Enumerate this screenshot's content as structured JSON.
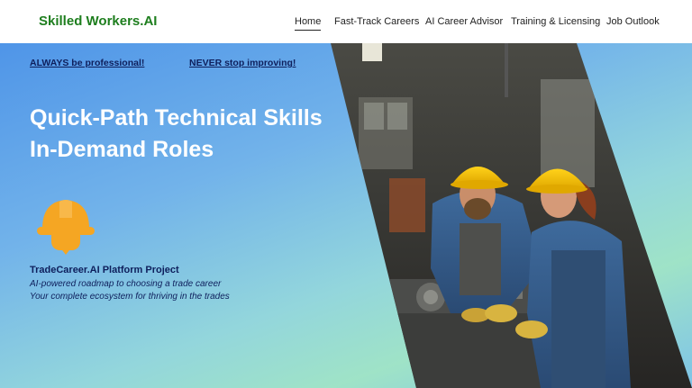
{
  "header": {
    "logo": "Skilled Workers.AI",
    "nav": [
      {
        "label": "Home",
        "active": true
      },
      {
        "label": "Fast-Track Careers",
        "active": false
      },
      {
        "label": "AI Career Advisor",
        "active": false
      },
      {
        "label": "Training & Licensing",
        "active": false
      },
      {
        "label": "Job Outlook",
        "active": false
      }
    ]
  },
  "hero": {
    "slogans": [
      "ALWAYS be professional!",
      "NEVER stop improving!"
    ],
    "headline": [
      "Quick-Path Technical Skills",
      "In-Demand  Roles"
    ],
    "project": {
      "title": "TradeCareer.AI Platform Project",
      "lines": [
        "AI-powered roadmap to choosing a trade career",
        "Your complete ecosystem for thriving in the trades"
      ]
    },
    "icon": "hard-hat-icon",
    "image": "workers-in-hard-hats-at-lathe-photo"
  },
  "colors": {
    "brand_green": "#1e7e1e",
    "navy_text": "#0e1f5c",
    "hardhat_orange": "#f5a623",
    "hero_blue": "#4f95e8",
    "hero_mint": "#9fe3c7"
  }
}
